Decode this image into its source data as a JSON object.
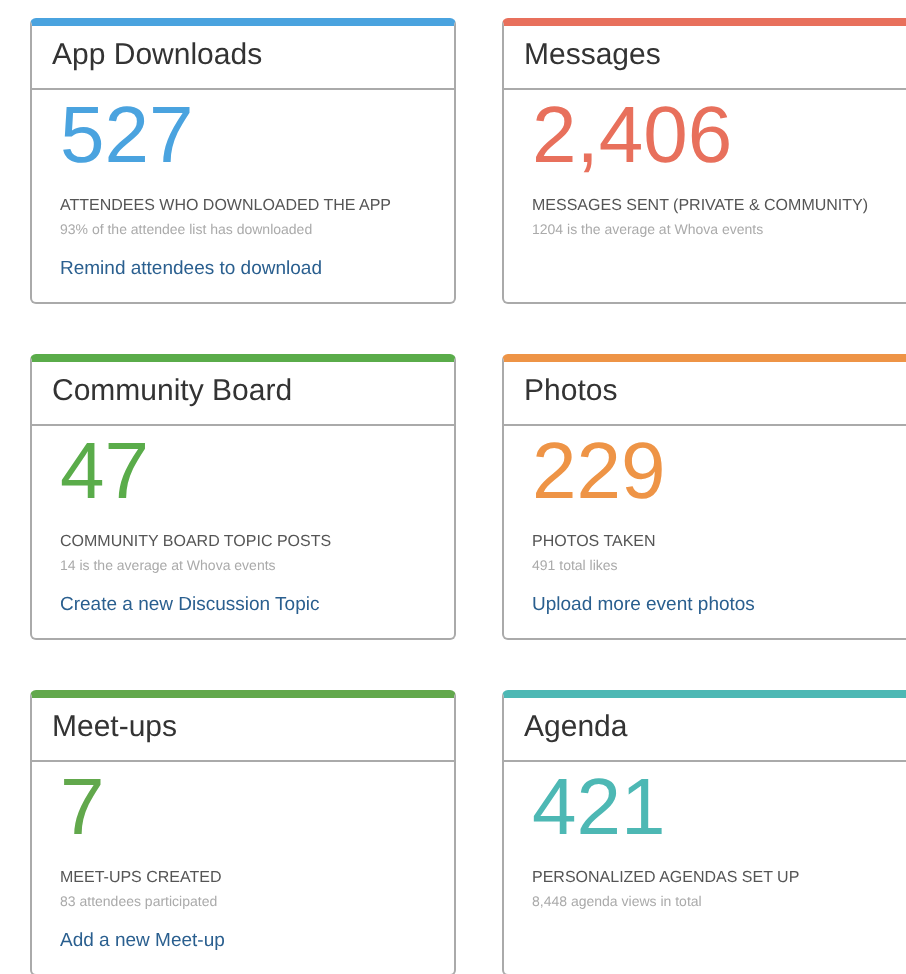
{
  "cards": [
    {
      "title": "App Downloads",
      "value": "527",
      "color": "#4aa3df",
      "caption": "ATTENDEES WHO DOWNLOADED THE APP",
      "note": "93% of the attendee list has downloaded",
      "link": "Remind attendees to download"
    },
    {
      "title": "Messages",
      "value": "2,406",
      "color": "#e8705c",
      "caption": "MESSAGES SENT (PRIVATE & COMMUNITY)",
      "note": "1204 is the average at Whova events"
    },
    {
      "title": "Community Board",
      "value": "47",
      "color": "#5aac4a",
      "caption": "COMMUNITY BOARD TOPIC POSTS",
      "note": "14 is the average at Whova events",
      "link": "Create a new Discussion Topic"
    },
    {
      "title": "Photos",
      "value": "229",
      "color": "#ee9446",
      "caption": "PHOTOS TAKEN",
      "note": "491 total likes",
      "link": "Upload more event photos"
    },
    {
      "title": "Meet-ups",
      "value": "7",
      "color": "#62a84c",
      "caption": "MEET-UPS CREATED",
      "note": "83 attendees participated",
      "link": "Add a new Meet-up"
    },
    {
      "title": "Agenda",
      "value": "421",
      "color": "#4db8b4",
      "caption": "PERSONALIZED AGENDAS SET UP",
      "note": "8,448 agenda views in total"
    }
  ]
}
